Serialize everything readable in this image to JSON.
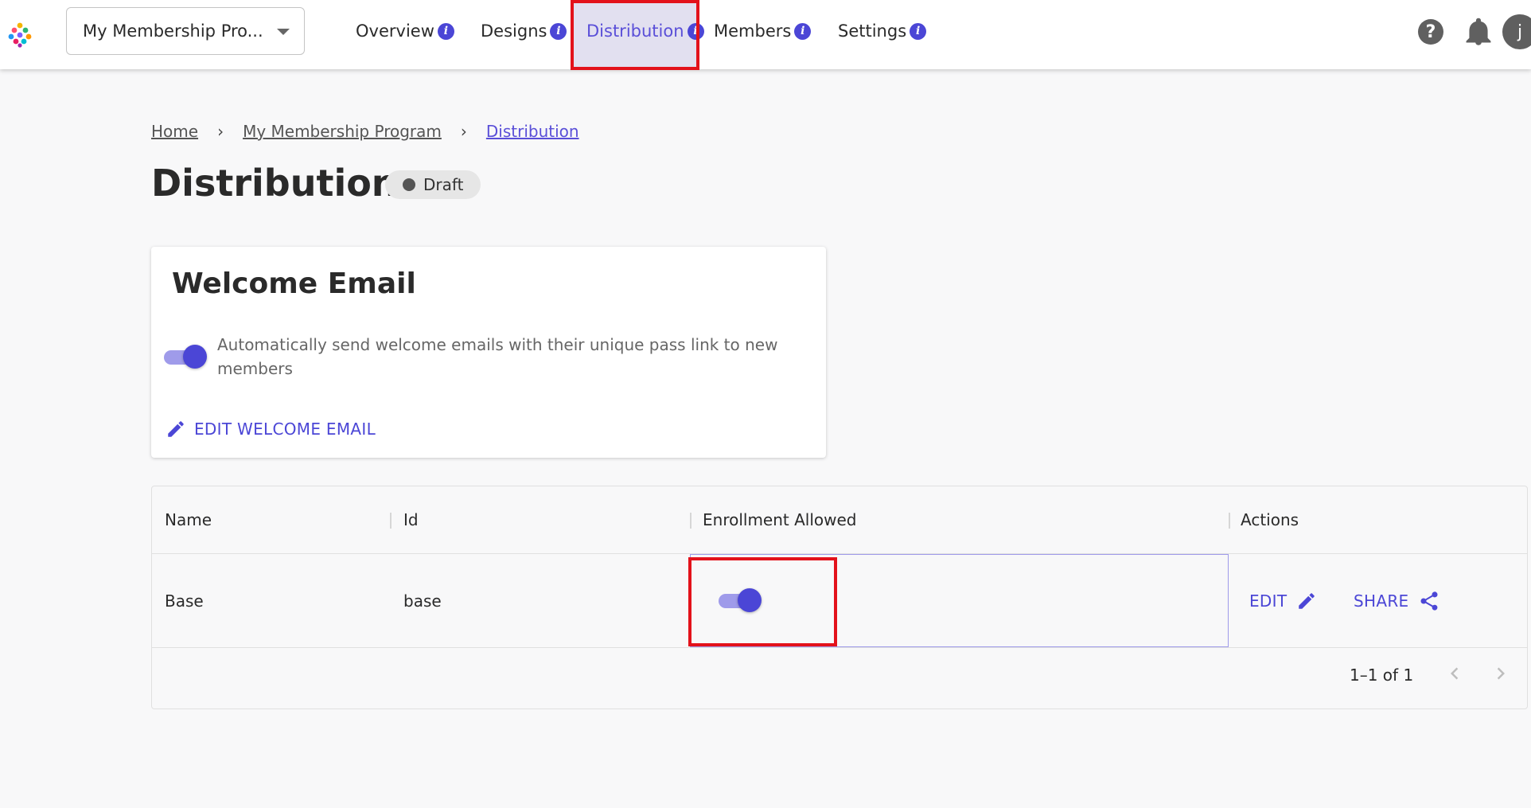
{
  "header": {
    "program_select": "My Membership Pro...",
    "tabs": [
      {
        "label": "Overview"
      },
      {
        "label": "Designs"
      },
      {
        "label": "Distribution"
      },
      {
        "label": "Members"
      },
      {
        "label": "Settings"
      }
    ],
    "active_tab": "Distribution",
    "avatar_initial": "j",
    "help_glyph": "?"
  },
  "breadcrumb": {
    "home": "Home",
    "program": "My Membership Program",
    "current": "Distribution"
  },
  "page": {
    "title": "Distribution",
    "status": "Draft"
  },
  "welcome_card": {
    "title": "Welcome Email",
    "toggle_on": true,
    "description": "Automatically send welcome emails with their unique pass link to new members",
    "edit_label": "EDIT WELCOME EMAIL"
  },
  "table": {
    "columns": [
      "Name",
      "Id",
      "Enrollment Allowed",
      "Actions"
    ],
    "rows": [
      {
        "name": "Base",
        "id": "base",
        "enrollment_allowed": true
      }
    ],
    "actions": {
      "edit": "EDIT",
      "share": "SHARE"
    },
    "pagination": "1–1 of 1"
  },
  "colors": {
    "accent": "#4b46d6",
    "accent_light": "#9f9bea",
    "highlight": "#e3121b"
  }
}
